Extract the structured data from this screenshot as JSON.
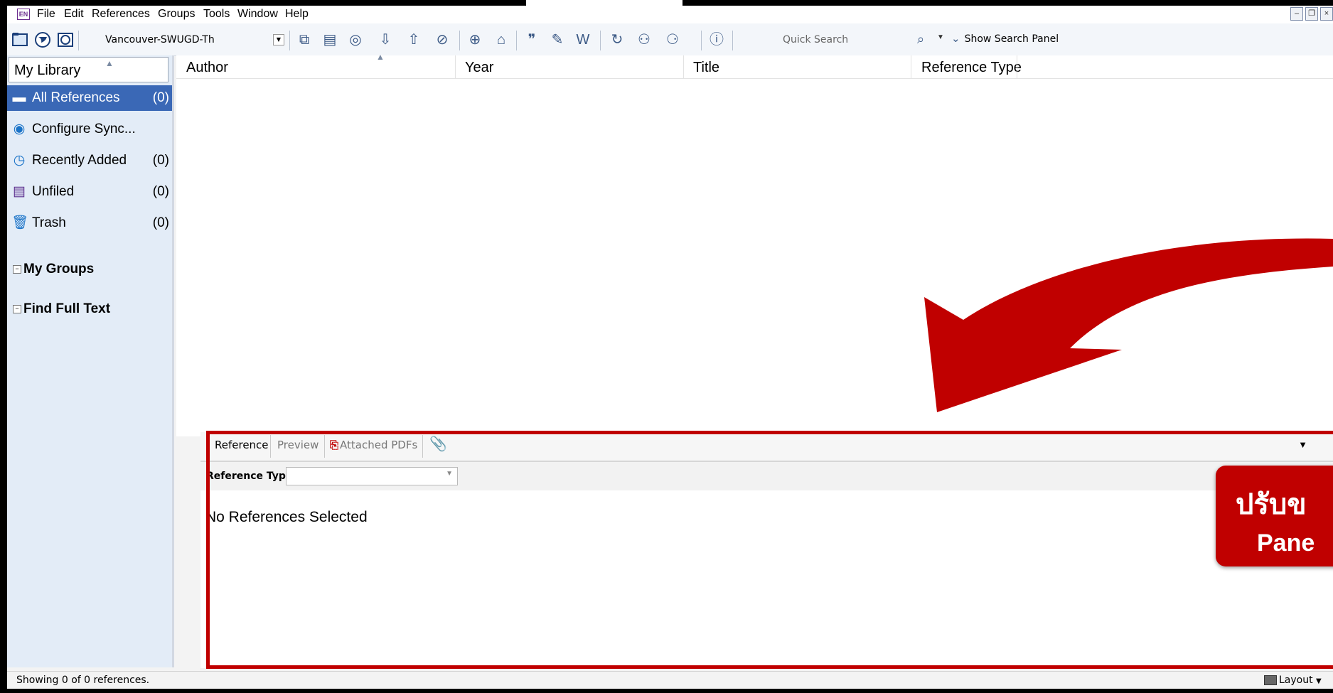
{
  "menubar": {
    "logo": "EN",
    "items": [
      "File",
      "Edit",
      "References",
      "Groups",
      "Tools",
      "Window",
      "Help"
    ]
  },
  "toolbar": {
    "style_value": "Vancouver-SWUGD-Th",
    "quick_search_placeholder": "Quick Search",
    "show_search_panel": "Show Search Panel"
  },
  "sidebar": {
    "header": "My Library",
    "items": [
      {
        "label": "All References",
        "count": "(0)",
        "icon": "all-references-icon"
      },
      {
        "label": "Configure Sync...",
        "count": "",
        "icon": "sync-icon"
      },
      {
        "label": "Recently Added",
        "count": "(0)",
        "icon": "clock-icon"
      },
      {
        "label": "Unfiled",
        "count": "(0)",
        "icon": "unfiled-icon"
      },
      {
        "label": "Trash",
        "count": "(0)",
        "icon": "trash-icon"
      }
    ],
    "groups": [
      "My Groups",
      "Find Full Text"
    ]
  },
  "columns": [
    "Author",
    "Year",
    "Title",
    "Reference Type"
  ],
  "preview": {
    "tabs": [
      "Reference",
      "Preview",
      "Attached PDFs"
    ],
    "ref_type_label": "Reference Type:",
    "empty_text": "No References Selected"
  },
  "callout": {
    "line1": "ปรับข",
    "line2": "Pane"
  },
  "status": {
    "text": "Showing 0 of 0 references.",
    "layout_label": "Layout"
  },
  "colors": {
    "accent": "#3a68b6",
    "annotation": "#c00000",
    "sidebar_bg": "#e3ecf7"
  }
}
